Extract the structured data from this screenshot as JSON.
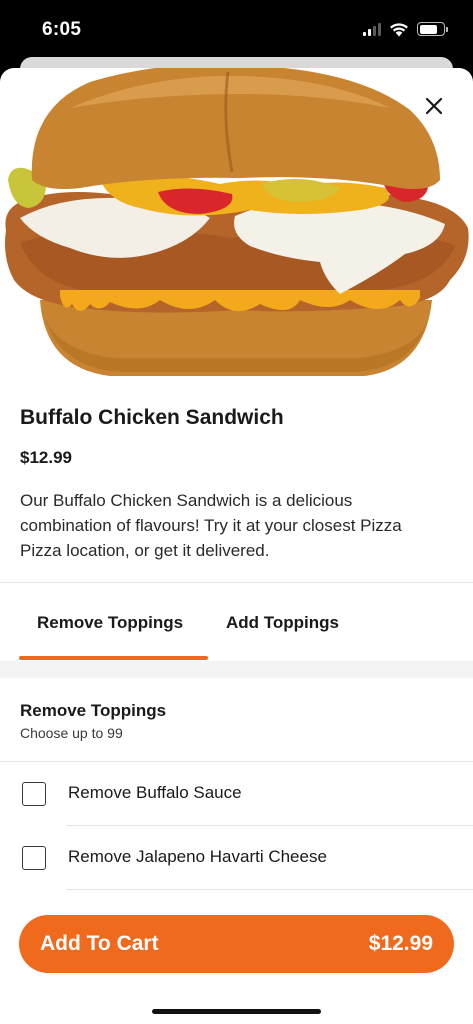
{
  "status_bar": {
    "time": "6:05",
    "signal_bars_active": 2,
    "signal_bars_total": 4,
    "battery_level": 0.75
  },
  "product": {
    "title": "Buffalo Chicken Sandwich",
    "price": "$12.99",
    "description": "Our Buffalo Chicken Sandwich is a delicious combination of flavours! Try it at your closest Pizza Pizza location, or get it delivered.",
    "image_icon": "sandwich-image"
  },
  "tabs": [
    {
      "label": "Remove Toppings",
      "active": true
    },
    {
      "label": "Add Toppings",
      "active": false
    }
  ],
  "section": {
    "title": "Remove Toppings",
    "subtitle": "Choose up to 99"
  },
  "options": [
    {
      "label": "Remove Buffalo Sauce",
      "checked": false
    },
    {
      "label": "Remove Jalapeno Havarti Cheese",
      "checked": false
    }
  ],
  "cart_button": {
    "label": "Add To Cart",
    "price": "$12.99"
  },
  "colors": {
    "accent": "#ef6a1c",
    "text": "#1a1a1a",
    "divider": "#e2e2e2"
  },
  "icons": {
    "close": "close-icon",
    "wifi": "wifi-icon",
    "battery": "battery-icon",
    "signal": "cellular-signal-icon",
    "checkbox": "checkbox-icon"
  }
}
